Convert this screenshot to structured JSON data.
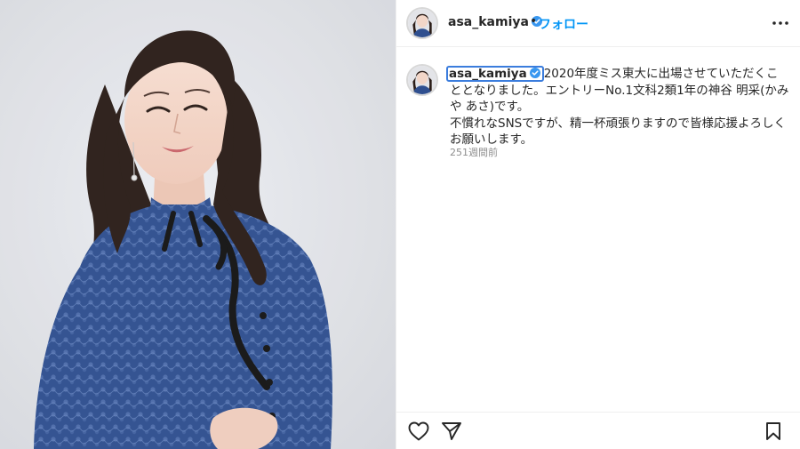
{
  "post": {
    "author": {
      "username": "asa_kamiya",
      "verified": true,
      "avatar_icon": "profile-photo-avatar"
    },
    "header": {
      "separator": "•",
      "follow_label": "フォロー",
      "more_icon": "more-options-icon"
    },
    "caption": {
      "username": "asa_kamiya",
      "text_line1": "2020年度ミス東大に出場させていただくこととなりました。エントリーNo.1文科2類1年の神谷 明采(かみや あさ)です。",
      "text_line2": "不慣れなSNSですが、精一杯頑張りますので皆様応援よろしくお願いします。",
      "timestamp": "251週間前"
    },
    "actions": {
      "like_icon": "heart-icon",
      "share_icon": "paper-plane-icon",
      "save_icon": "bookmark-icon"
    },
    "colors": {
      "link_blue": "#0095f6",
      "verified_blue": "#3897f0",
      "dress_blue": "#2f4f8f",
      "background_gray": "#e2e3e7"
    }
  }
}
